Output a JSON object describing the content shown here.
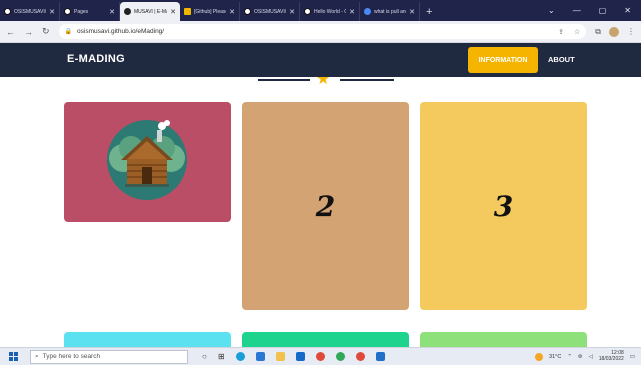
{
  "browser": {
    "tabs": [
      {
        "title": "OSISMUSAVI/eM",
        "active": false,
        "favicon": "github-icon"
      },
      {
        "title": "Pages",
        "active": false,
        "favicon": "github-icon"
      },
      {
        "title": "MUSAVI | E-Madi",
        "active": true,
        "favicon": "github-icon"
      },
      {
        "title": "[Github] Please",
        "active": false,
        "favicon": "mail-icon"
      },
      {
        "title": "OSISMUSAVI/sho",
        "active": false,
        "favicon": "github-icon"
      },
      {
        "title": "Hello World - Gi",
        "active": false,
        "favicon": "github-icon"
      },
      {
        "title": "what is pull and",
        "active": false,
        "favicon": "google-icon"
      }
    ],
    "url": "osismusavi.github.io/eMading/"
  },
  "site": {
    "brand": "E-MADING",
    "nav": {
      "information": "INFORMATION",
      "about": "ABOUT"
    },
    "cards": [
      {
        "type": "image",
        "icon": "log-cabin-icon",
        "color": "#b94e66"
      },
      {
        "label": "2",
        "color": "#d4a373"
      },
      {
        "label": "3",
        "color": "#f4c95d"
      },
      {
        "color": "#5ce1f0"
      },
      {
        "color": "#1ed38e"
      },
      {
        "color": "#8de07a"
      }
    ],
    "accent": "#f4b400",
    "header_bg": "#1f2940"
  },
  "taskbar": {
    "search_placeholder": "Type here to search",
    "weather": "31°C",
    "time": "12:08",
    "date": "18/03/2022"
  }
}
